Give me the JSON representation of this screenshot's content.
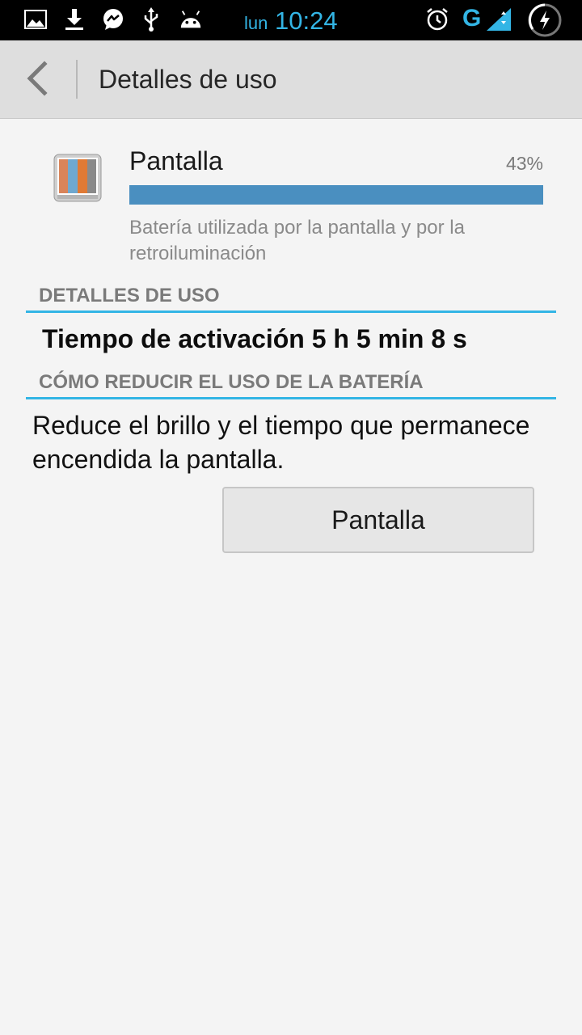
{
  "status_bar": {
    "day": "lun",
    "time": "10:24",
    "network": "G",
    "icons": [
      "image-icon",
      "download-icon",
      "messenger-icon",
      "usb-icon",
      "android-icon",
      "alarm-icon",
      "signal-icon",
      "battery-charging-icon"
    ],
    "accent_color": "#33b5e5"
  },
  "action_bar": {
    "title": "Detalles de uso"
  },
  "app": {
    "name": "Pantalla",
    "percent": "43%",
    "usage_fraction": 1.0,
    "description": "Batería utilizada por la pantalla y por la retroiluminación",
    "bar_color": "#4a8fc0"
  },
  "sections": {
    "usage_details": "DETALLES DE USO",
    "reduce_usage": "CÓMO REDUCIR EL USO DE LA BATERÍA"
  },
  "details": {
    "active_time": "Tiempo de activación 5 h 5 min 8 s"
  },
  "tip": {
    "text": "Reduce el brillo y el tiempo que permanece encendida la pantalla.",
    "button_label": "Pantalla"
  }
}
